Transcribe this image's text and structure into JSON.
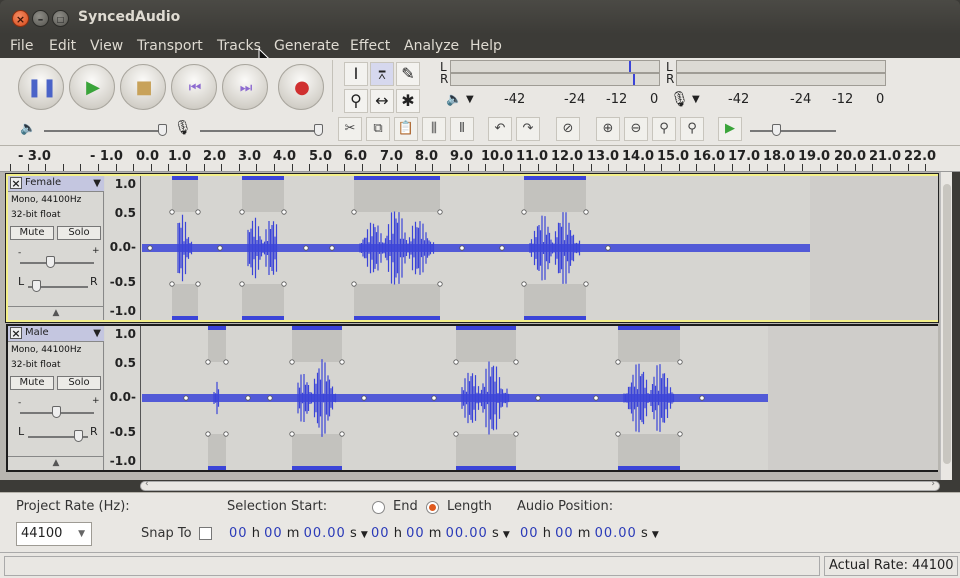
{
  "window": {
    "title": "SyncedAudio"
  },
  "menu": [
    "File",
    "Edit",
    "View",
    "Transport",
    "Tracks",
    "Generate",
    "Effect",
    "Analyze",
    "Help"
  ],
  "transport_icons": [
    "pause-icon",
    "play-icon",
    "stop-icon",
    "skip-start-icon",
    "skip-end-icon",
    "record-icon"
  ],
  "meters": {
    "play_lr": [
      "L",
      "R"
    ],
    "rec_lr": [
      "L",
      "R"
    ],
    "play_ticks": [
      "-42",
      "-24",
      "-12",
      "0"
    ],
    "rec_ticks": [
      "-42",
      "-24",
      "-12",
      "0"
    ]
  },
  "ruler": {
    "labels": [
      "- 3.0",
      "- 1.0",
      "0.0",
      "1.0",
      "2.0",
      "3.0",
      "4.0",
      "5.0",
      "6.0",
      "7.0",
      "8.0",
      "9.0",
      "10.0",
      "11.0",
      "12.0",
      "13.0",
      "14.0",
      "15.0",
      "16.0",
      "17.0",
      "18.0",
      "19.0",
      "20.0",
      "21.0",
      "22.0"
    ]
  },
  "tracks": [
    {
      "name": "Female",
      "format": "Mono, 44100Hz",
      "bits": "32-bit float",
      "mute": "Mute",
      "solo": "Solo",
      "pan_l": "L",
      "pan_r": "R",
      "scale": [
        "1.0",
        "0.5",
        "0.0-",
        "-0.5",
        "-1.0"
      ]
    },
    {
      "name": "Male",
      "format": "Mono, 44100Hz",
      "bits": "32-bit float",
      "mute": "Mute",
      "solo": "Solo",
      "pan_l": "L",
      "pan_r": "R",
      "scale": [
        "1.0",
        "0.5",
        "0.0-",
        "-0.5",
        "-1.0"
      ]
    }
  ],
  "selection": {
    "project_rate_label": "Project Rate (Hz):",
    "project_rate": "44100",
    "snap_to": "Snap To",
    "sel_start_label": "Selection Start:",
    "end_label": "End",
    "length_label": "Length",
    "audio_position_label": "Audio Position:",
    "time_h": "00",
    "time_m": "00",
    "time_s": "00.00",
    "u_h": "h",
    "u_m": "m",
    "u_s": "s"
  },
  "status": {
    "actual_rate": "Actual Rate: 44100"
  },
  "colors": {
    "wave": "#3b44d8",
    "selected_border": "#f4f088",
    "title_bg": "#3c3b37"
  }
}
